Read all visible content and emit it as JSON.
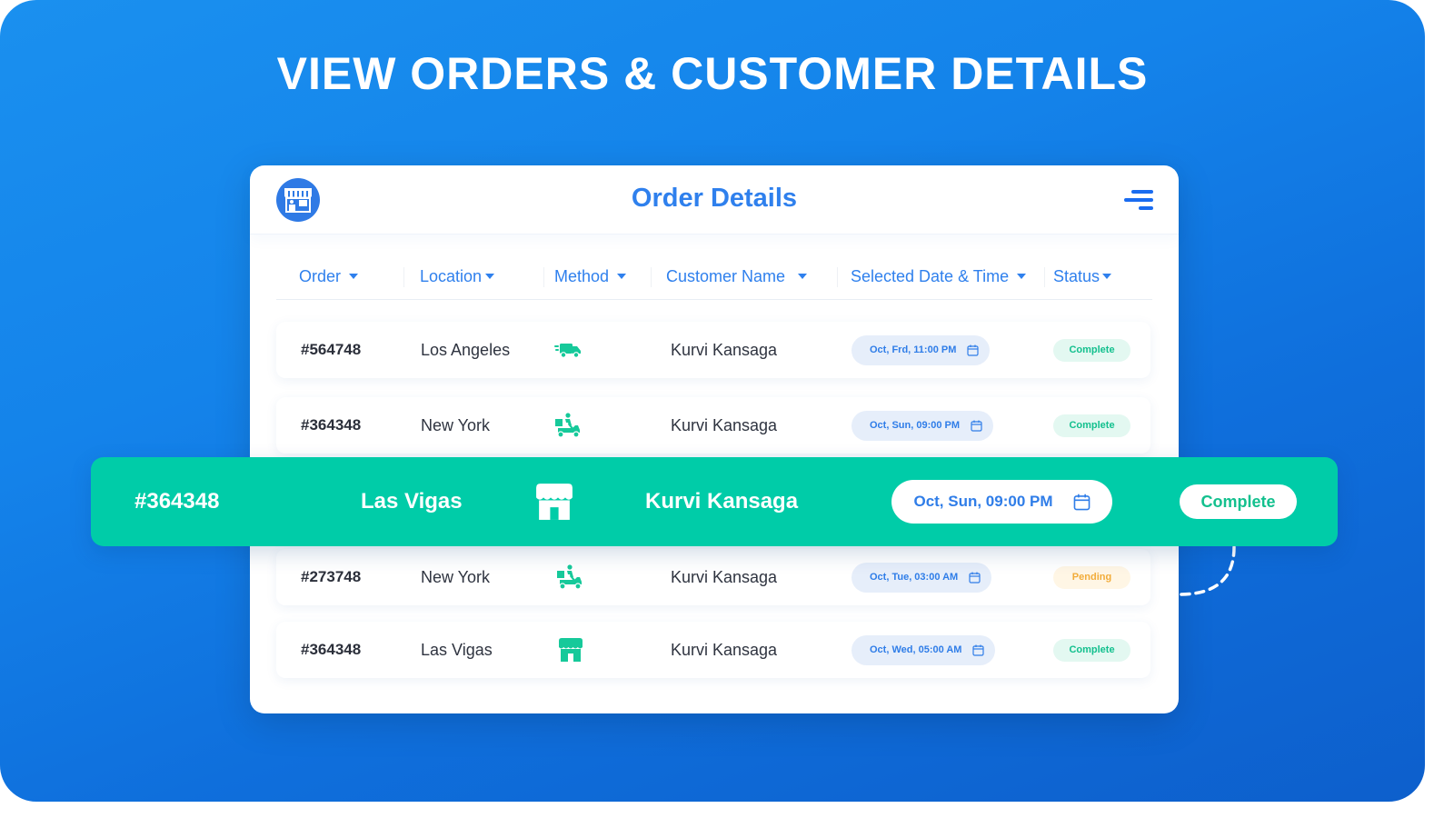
{
  "hero": {
    "title": "VIEW ORDERS & CUSTOMER DETAILS"
  },
  "card": {
    "logo_icon": "storefront-icon",
    "title": "Order Details",
    "menu_icon": "hamburger-menu-icon"
  },
  "table": {
    "columns": [
      {
        "label": "Order"
      },
      {
        "label": "Location"
      },
      {
        "label": "Method"
      },
      {
        "label": "Customer Name"
      },
      {
        "label": "Selected Date & Time"
      },
      {
        "label": "Status"
      }
    ],
    "rows": [
      {
        "order": "#564748",
        "location": "Los Angeles",
        "method": "delivery-truck-icon",
        "customer": "Kurvi Kansaga",
        "datetime": "Oct, Frd, 11:00 PM",
        "status": "Complete"
      },
      {
        "order": "#364348",
        "location": "New York",
        "method": "scooter-courier-icon",
        "customer": "Kurvi Kansaga",
        "datetime": "Oct, Sun, 09:00 PM",
        "status": "Complete"
      },
      {
        "order": "#273748",
        "location": "New York",
        "method": "scooter-courier-icon",
        "customer": "Kurvi Kansaga",
        "datetime": "Oct, Tue, 03:00 AM",
        "status": "Pending"
      },
      {
        "order": "#364348",
        "location": "Las Vigas",
        "method": "storefront-pickup-icon",
        "customer": "Kurvi Kansaga",
        "datetime": "Oct, Wed, 05:00 AM",
        "status": "Complete"
      }
    ]
  },
  "highlight": {
    "order": "#364348",
    "location": "Las Vigas",
    "method": "storefront-pickup-icon",
    "customer": "Kurvi Kansaga",
    "datetime": "Oct, Sun, 09:00 PM",
    "status": "Complete"
  },
  "colors": {
    "background_blue": "#1483ea",
    "accent_blue": "#2f80ed",
    "highlight_green": "#00cca8",
    "status_complete": "#13c08e",
    "status_pending": "#f2ac3a"
  }
}
